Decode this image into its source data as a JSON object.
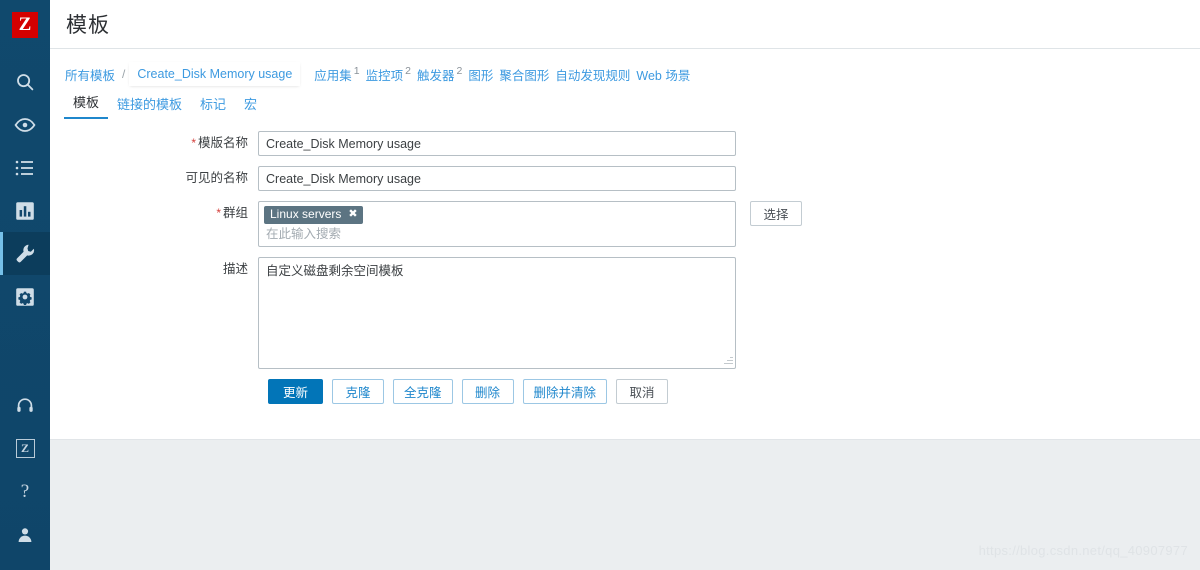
{
  "brand": {
    "logo_text": "Z",
    "logo_bg": "#d40000",
    "sidebar_bg": "#0e4a6e",
    "accent": "#1f87cc",
    "link_color": "#3d9ae0"
  },
  "sidebar": {
    "items": [
      {
        "name": "search-icon",
        "icon": "search",
        "active": false
      },
      {
        "name": "monitoring-icon",
        "icon": "eye",
        "active": false
      },
      {
        "name": "inventory-icon",
        "icon": "list",
        "active": false
      },
      {
        "name": "reports-icon",
        "icon": "chart",
        "active": false
      },
      {
        "name": "configuration-icon",
        "icon": "wrench",
        "active": true
      },
      {
        "name": "administration-icon",
        "icon": "gear",
        "active": false
      }
    ],
    "bottom_items": [
      {
        "name": "support-icon",
        "icon": "headset"
      },
      {
        "name": "zabbix-share-icon",
        "icon": "zmini"
      },
      {
        "name": "help-icon",
        "icon": "question"
      },
      {
        "name": "user-profile-icon",
        "icon": "person"
      }
    ]
  },
  "header": {
    "title": "模板"
  },
  "breadcrumb": {
    "root": "所有模板",
    "separator": "/",
    "current": "Create_Disk Memory usage",
    "links": [
      {
        "label": "应用集",
        "count": "1"
      },
      {
        "label": "监控项",
        "count": "2"
      },
      {
        "label": "触发器",
        "count": "2"
      },
      {
        "label": "图形",
        "count": ""
      },
      {
        "label": "聚合图形",
        "count": ""
      },
      {
        "label": "自动发现规则",
        "count": ""
      },
      {
        "label": "Web 场景",
        "count": ""
      }
    ]
  },
  "tabs": [
    {
      "label": "模板",
      "active": true
    },
    {
      "label": "链接的模板",
      "active": false
    },
    {
      "label": "标记",
      "active": false
    },
    {
      "label": "宏",
      "active": false
    }
  ],
  "form": {
    "template_name": {
      "label": "模版名称",
      "required": true,
      "value": "Create_Disk Memory usage"
    },
    "visible_name": {
      "label": "可见的名称",
      "required": false,
      "value": "Create_Disk Memory usage"
    },
    "groups": {
      "label": "群组",
      "required": true,
      "chips": [
        "Linux servers"
      ],
      "chip_remove": "✖",
      "placeholder": "在此输入搜索",
      "select_button": "选择"
    },
    "description": {
      "label": "描述",
      "required": false,
      "value": "自定义磁盘剩余空间模板"
    }
  },
  "actions": [
    {
      "label": "更新",
      "style": "primary"
    },
    {
      "label": "克隆",
      "style": "secondary"
    },
    {
      "label": "全克隆",
      "style": "secondary"
    },
    {
      "label": "删除",
      "style": "secondary"
    },
    {
      "label": "删除并清除",
      "style": "secondary"
    },
    {
      "label": "取消",
      "style": "secondary-gray"
    }
  ],
  "watermark": "https://blog.csdn.net/qq_40907977"
}
